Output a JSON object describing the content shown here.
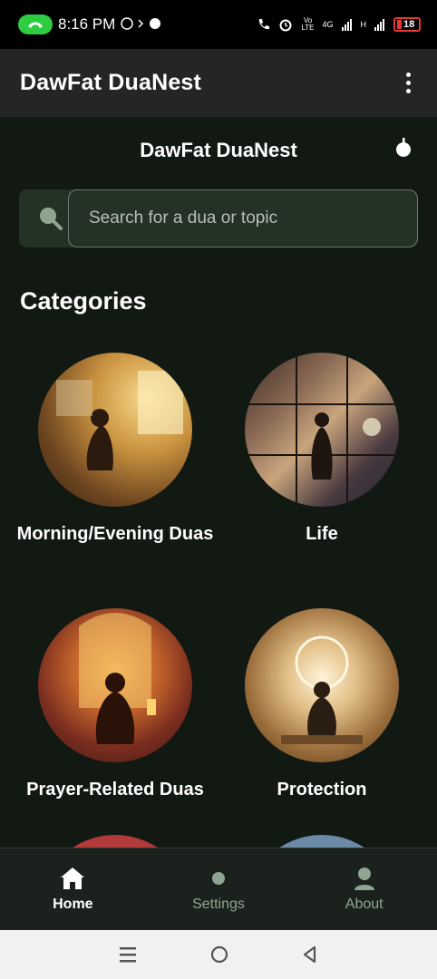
{
  "status_bar": {
    "time": "8:16 PM",
    "mini_icons": "ⓑ",
    "battery": "18",
    "network_text": "4G",
    "network_text2": "H",
    "volte": "Vo LTE"
  },
  "app_bar": {
    "title": "DawFat DuaNest"
  },
  "header": {
    "title": "DawFat DuaNest"
  },
  "search": {
    "placeholder": "Search for a dua or topic"
  },
  "categories": {
    "title": "Categories",
    "items": [
      {
        "label": "Morning/Evening Duas"
      },
      {
        "label": "Life"
      },
      {
        "label": "Prayer-Related Duas"
      },
      {
        "label": "Protection"
      }
    ]
  },
  "bottom_nav": {
    "items": [
      {
        "label": "Home",
        "icon": "home-icon",
        "active": true
      },
      {
        "label": "Settings",
        "icon": "settings-dot-icon",
        "active": false
      },
      {
        "label": "About",
        "icon": "person-icon",
        "active": false
      }
    ]
  },
  "colors": {
    "background": "#121812",
    "app_bar": "#232625",
    "accent_green": "#8fa592",
    "search_bg": "#243226"
  }
}
